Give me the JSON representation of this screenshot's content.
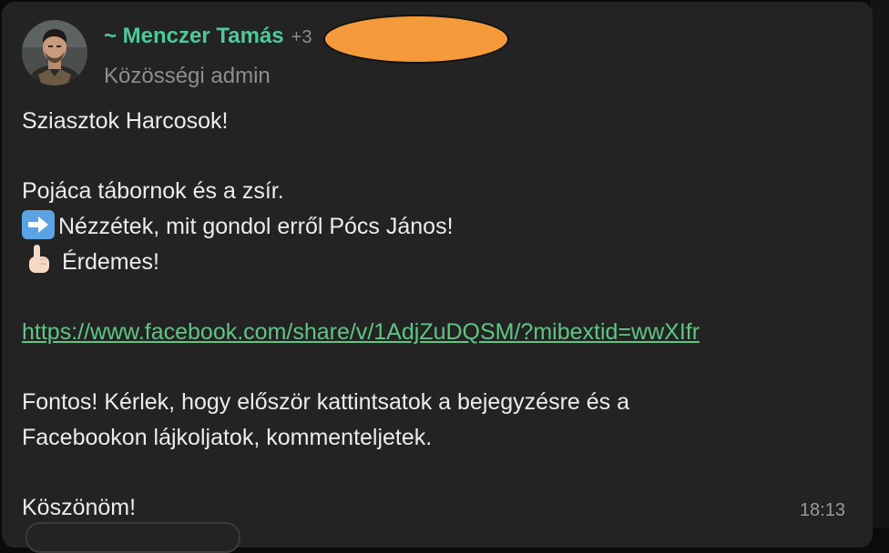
{
  "message": {
    "sender": {
      "name": "~ Menczer Tamás",
      "phone_visible": "+3",
      "role": "Közösségi admin",
      "avatar_icon": "profile-photo"
    },
    "lines": [
      "Sziasztok Harcosok!",
      "",
      "Pojáca tábornok és a zsír.",
      "Nézzétek, mit gondol erről Pócs János!",
      "Érdemes!",
      "",
      "https://www.facebook.com/share/v/1AdjZuDQSM/?mibextid=wwXIfr",
      "",
      "Fontos! Kérlek, hogy először kattintsatok a bejegyzésre és a",
      "Facebookon lájkoljatok, kommenteljetek.",
      "",
      "Köszönöm!"
    ],
    "emojis": {
      "arrow": "right-arrow-emoji",
      "finger": "pointing-up-emoji"
    },
    "timestamp": "18:13"
  },
  "colors": {
    "bubble_bg": "#232323",
    "sender_name": "#4fc99a",
    "link": "#5fc583",
    "text": "#ececec",
    "muted": "#8e8e8e",
    "redaction": "#f49a3a"
  }
}
